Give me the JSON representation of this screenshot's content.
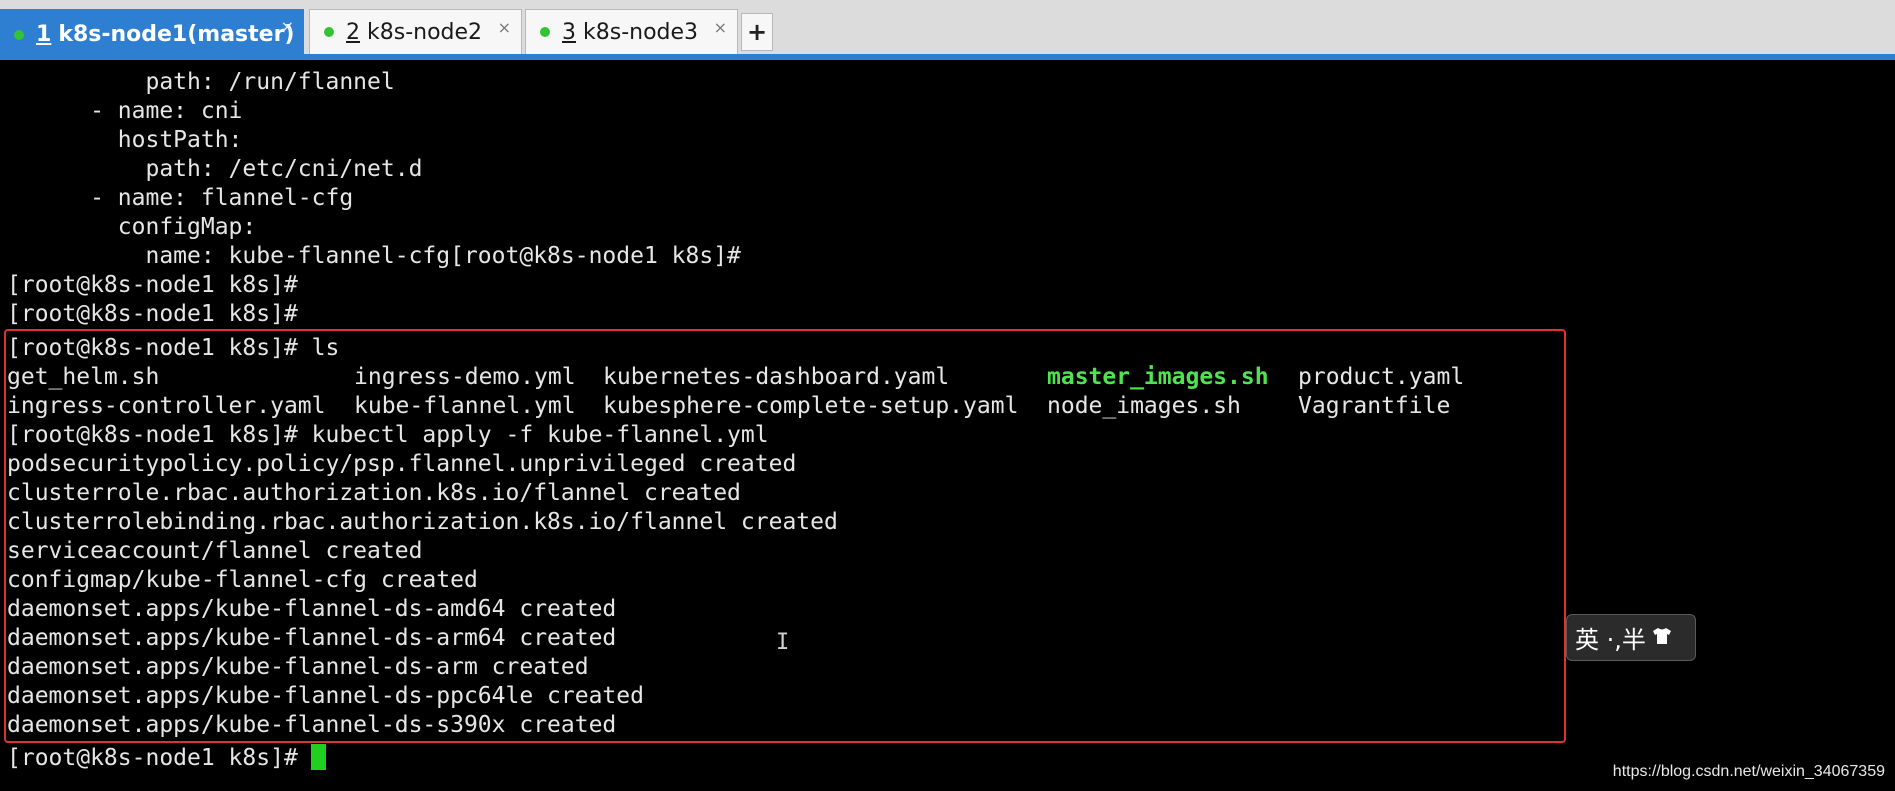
{
  "tabs": [
    {
      "number": "1",
      "title": "k8s-node1(master)",
      "status_color": "#34c334",
      "close": "×"
    },
    {
      "number": "2",
      "title": "k8s-node2",
      "status_color": "#34c334",
      "close": "×"
    },
    {
      "number": "3",
      "title": "k8s-node3",
      "status_color": "#34c334",
      "close": "×"
    }
  ],
  "new_tab_label": "+",
  "terminal": {
    "lines": [
      "          path: /run/flannel",
      "      - name: cni",
      "        hostPath:",
      "          path: /etc/cni/net.d",
      "      - name: flannel-cfg",
      "        configMap:",
      "          name: kube-flannel-cfg[root@k8s-node1 k8s]#",
      "[root@k8s-node1 k8s]#",
      "[root@k8s-node1 k8s]#",
      "[root@k8s-node1 k8s]# ls"
    ],
    "ls_rows": [
      [
        "get_helm.sh",
        "ingress-demo.yml",
        "kubernetes-dashboard.yaml",
        "master_images.sh",
        "product.yaml"
      ],
      [
        "ingress-controller.yaml",
        "kube-flannel.yml",
        "kubesphere-complete-setup.yaml",
        "node_images.sh",
        "Vagrantfile"
      ]
    ],
    "after_lines": [
      "[root@k8s-node1 k8s]# kubectl apply -f kube-flannel.yml",
      "podsecuritypolicy.policy/psp.flannel.unprivileged created",
      "clusterrole.rbac.authorization.k8s.io/flannel created",
      "clusterrolebinding.rbac.authorization.k8s.io/flannel created",
      "serviceaccount/flannel created",
      "configmap/kube-flannel-cfg created",
      "daemonset.apps/kube-flannel-ds-amd64 created",
      "daemonset.apps/kube-flannel-ds-arm64 created",
      "daemonset.apps/kube-flannel-ds-arm created",
      "daemonset.apps/kube-flannel-ds-ppc64le created",
      "daemonset.apps/kube-flannel-ds-s390x created"
    ],
    "prompt": "[root@k8s-node1 k8s]#",
    "foreground_color": "#e6e6e6",
    "executable_color": "#4fe34f",
    "cursor_color": "#1fd01f",
    "highlight_color": "#e03131"
  },
  "ime": {
    "text": "英 ·,半",
    "icon": "tshirt-icon"
  },
  "watermark": "https://blog.csdn.net/weixin_34067359"
}
